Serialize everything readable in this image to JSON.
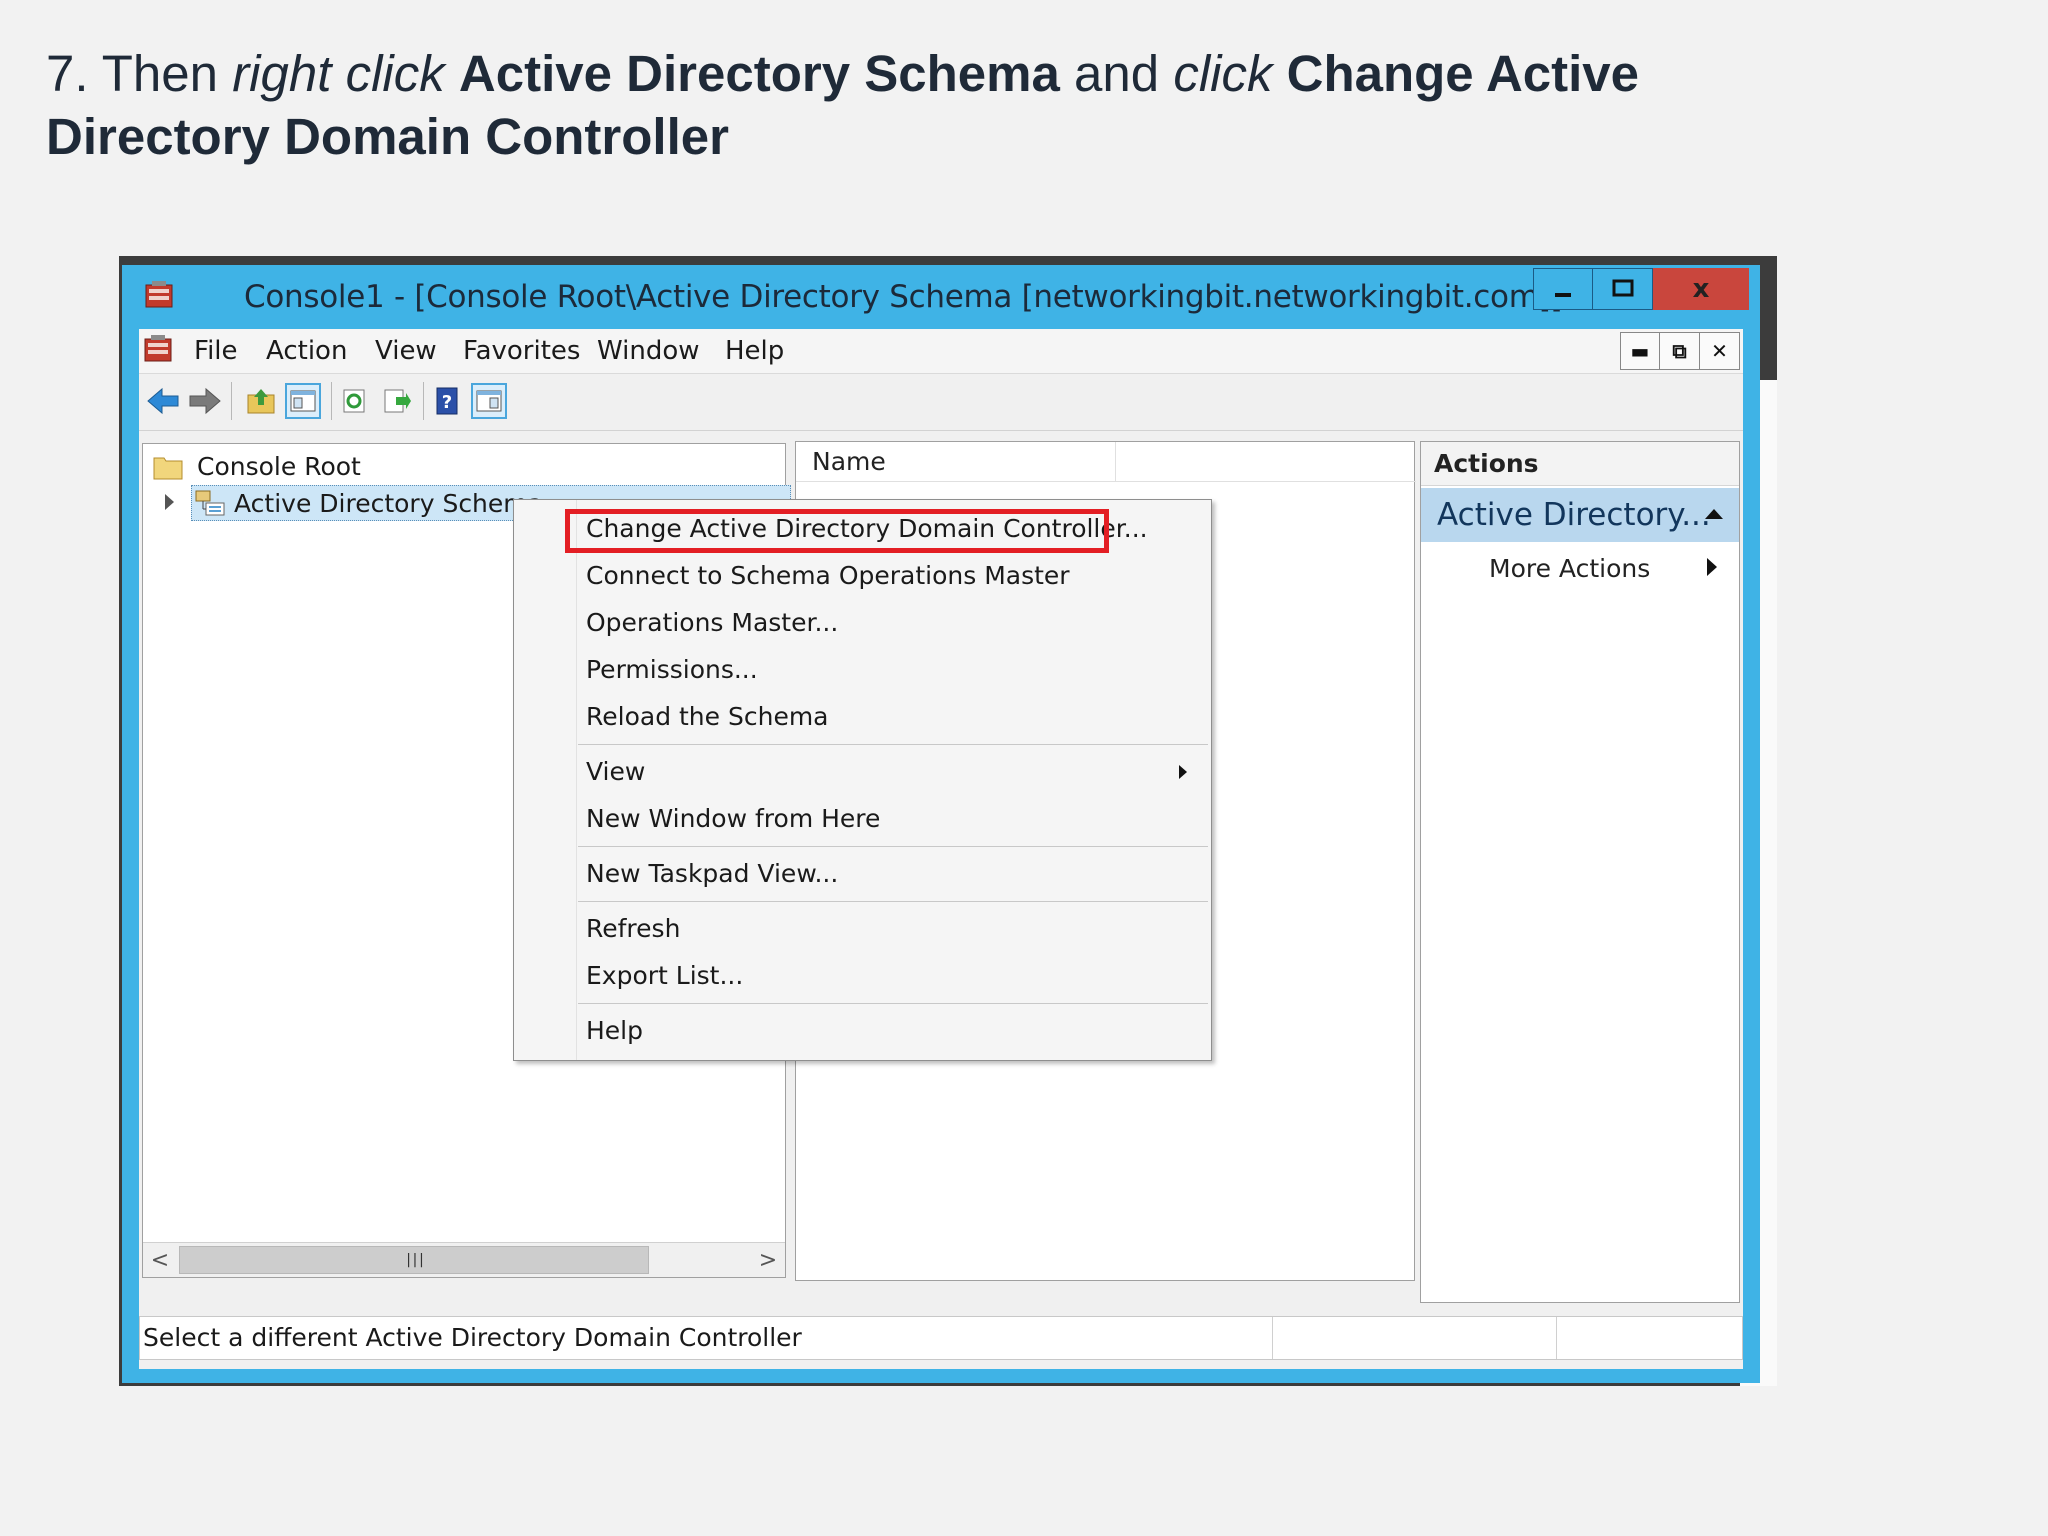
{
  "instruction": {
    "step": "7. Then ",
    "action1": "right click",
    "target1": "Active Directory Schema",
    "connector": " and ",
    "action2": "click",
    "target2": "Change Active Directory Domain Controller"
  },
  "window": {
    "title": "Console1 - [Console Root\\Active Directory Schema [networkingbit.networkingbit.com]]",
    "close_label": "x"
  },
  "menubar": {
    "items": [
      "File",
      "Action",
      "View",
      "Favorites",
      "Window",
      "Help"
    ]
  },
  "tree": {
    "root": "Console Root",
    "child": "Active Directory Schema"
  },
  "list": {
    "column_name": "Name"
  },
  "actions": {
    "header": "Actions",
    "group": "Active Directory...",
    "more_actions": "More Actions"
  },
  "context_menu": {
    "items": [
      "Change Active Directory Domain Controller...",
      "Connect to Schema Operations Master",
      "Operations Master...",
      "Permissions...",
      "Reload the Schema",
      "View",
      "New Window from Here",
      "New Taskpad View...",
      "Refresh",
      "Export List...",
      "Help"
    ]
  },
  "status": {
    "text": "Select a different Active Directory Domain Controller"
  },
  "colors": {
    "window_frame": "#3fb3e6",
    "close_button": "#c9463d",
    "highlight_box": "#e31e24",
    "selection": "#cde6f7",
    "actions_group": "#b9d7ee"
  }
}
